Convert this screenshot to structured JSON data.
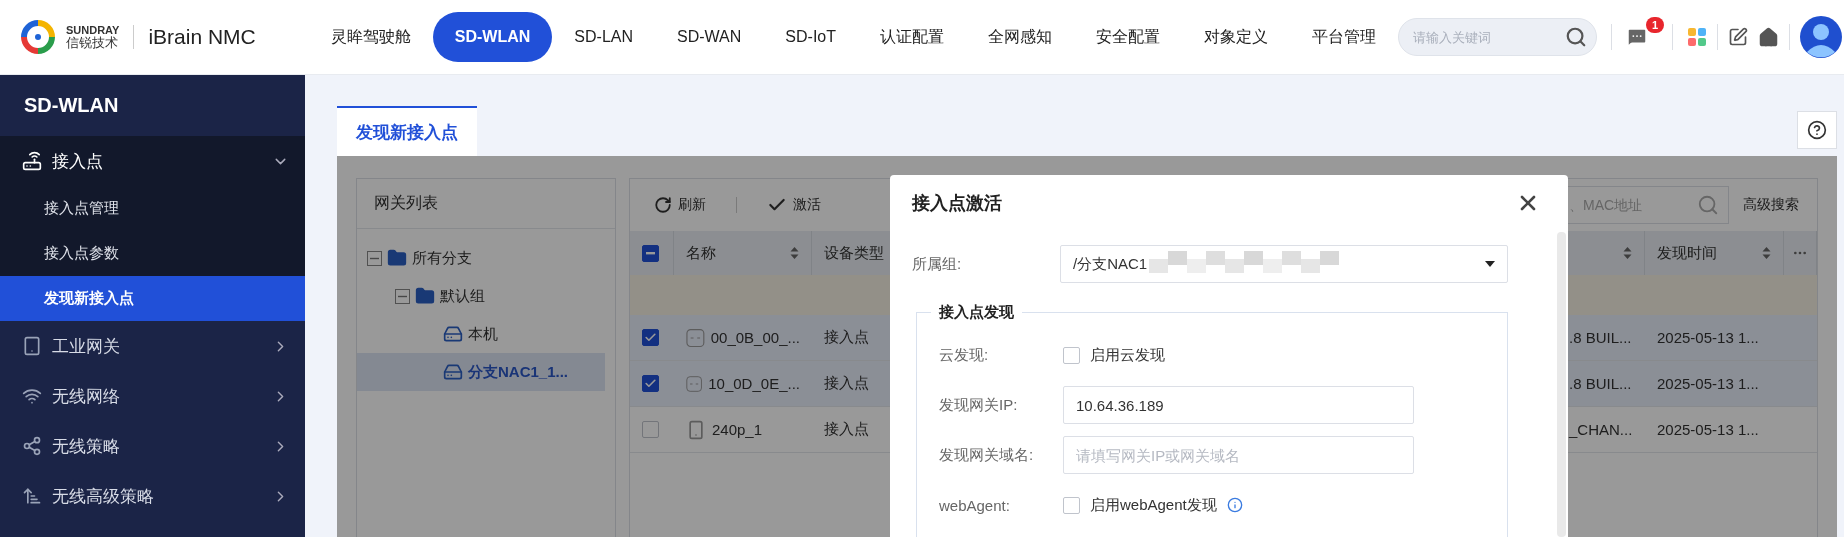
{
  "header": {
    "logo": {
      "brand": "SUNDRAY",
      "brand_cn": "信锐技术",
      "product": "iBrain NMC"
    },
    "nav": [
      {
        "label": "灵眸驾驶舱",
        "selected": false
      },
      {
        "label": "SD-WLAN",
        "selected": true
      },
      {
        "label": "SD-LAN",
        "selected": false
      },
      {
        "label": "SD-WAN",
        "selected": false
      },
      {
        "label": "SD-IoT",
        "selected": false
      },
      {
        "label": "认证配置",
        "selected": false
      },
      {
        "label": "全网感知",
        "selected": false
      },
      {
        "label": "安全配置",
        "selected": false
      },
      {
        "label": "对象定义",
        "selected": false
      },
      {
        "label": "平台管理",
        "selected": false
      }
    ],
    "search": {
      "placeholder": "请输入关键词"
    },
    "notification_count": "1"
  },
  "sidebar": {
    "title": "SD-WLAN",
    "items": [
      {
        "label": "接入点",
        "expanded": true,
        "children": [
          {
            "label": "接入点管理",
            "selected": false
          },
          {
            "label": "接入点参数",
            "selected": false
          },
          {
            "label": "发现新接入点",
            "selected": true
          }
        ]
      },
      {
        "label": "工业网关",
        "expanded": false
      },
      {
        "label": "无线网络",
        "expanded": false
      },
      {
        "label": "无线策略",
        "expanded": false
      },
      {
        "label": "无线高级策略",
        "expanded": false
      }
    ]
  },
  "tabs": [
    {
      "label": "发现新接入点",
      "selected": true
    }
  ],
  "gateway_list": {
    "title": "网关列表",
    "tree": [
      {
        "label": "所有分支",
        "kind": "folder",
        "expanded": true,
        "selected": false,
        "children": [
          {
            "label": "默认组",
            "kind": "folder",
            "expanded": true,
            "selected": false,
            "children": [
              {
                "label": "本机",
                "kind": "gateway",
                "selected": false
              },
              {
                "label": "分支NAC1_1...",
                "kind": "gateway",
                "selected": true
              }
            ]
          }
        ]
      }
    ]
  },
  "device_table": {
    "toolbar": [
      {
        "label": "刷新",
        "kind": "refresh"
      },
      {
        "label": "激活",
        "kind": "activate"
      }
    ],
    "search": {
      "placeholder": "、MAC地址"
    },
    "advanced_search": "高级搜索",
    "header_checkbox": {
      "indeterminate": true
    },
    "columns": [
      {
        "label": "名称",
        "sortable": true
      },
      {
        "label": "设备类型"
      },
      {
        "sortable": true
      },
      {
        "label": "发现时间",
        "sortable": true
      }
    ],
    "rows": [
      {
        "checked": true,
        "kind": "ap",
        "name": "00_0B_00_...",
        "type": "接入点",
        "column_4": ".8 BUIL...",
        "time": "2025-05-13 1..."
      },
      {
        "checked": true,
        "kind": "ap",
        "name": "10_0D_0E_...",
        "type": "接入点",
        "column_4": ".8 BUIL...",
        "time": "2025-05-13 1..."
      },
      {
        "checked": false,
        "kind": "handset",
        "name": "240p_1",
        "type": "接入点",
        "column_4": "_CHAN...",
        "time": "2025-05-13 1..."
      }
    ]
  },
  "modal": {
    "title": "接入点激活",
    "group": {
      "label": "所属组:",
      "value": "/分支NAC1"
    },
    "section": "接入点发现",
    "fields": [
      {
        "kind": "checkbox",
        "label": "云发现:",
        "option": "启用云发现",
        "checked": false,
        "info": false
      },
      {
        "kind": "input",
        "label": "发现网关IP:",
        "value": "10.64.36.189"
      },
      {
        "kind": "input",
        "label": "发现网关域名:",
        "placeholder": "请填写网关IP或网关域名"
      },
      {
        "kind": "checkbox",
        "label": "webAgent:",
        "option": "启用webAgent发现",
        "checked": false,
        "info": true
      }
    ]
  }
}
